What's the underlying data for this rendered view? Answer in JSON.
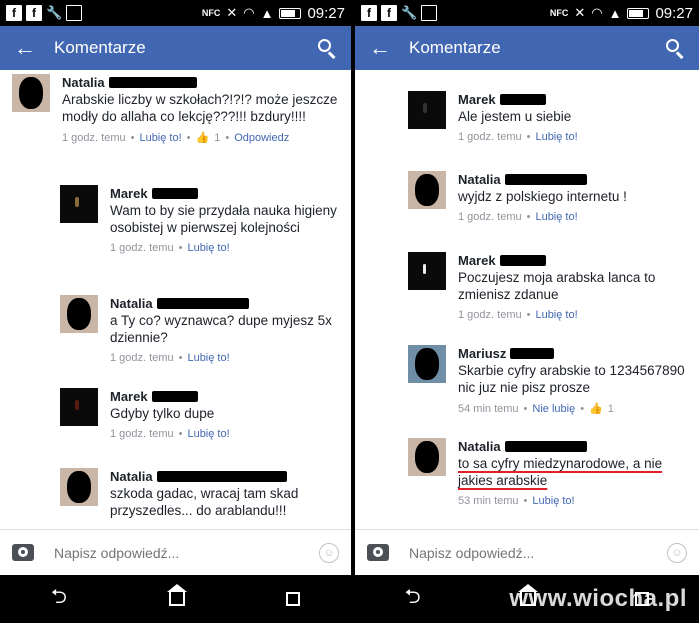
{
  "status": {
    "time": "09:27",
    "nfc": "NFC"
  },
  "appbar": {
    "title": "Komentarze"
  },
  "reply": {
    "placeholder": "Napisz odpowiedź..."
  },
  "left_comments": [
    {
      "name": "Natalia",
      "text": "Arabskie liczby w szkołach?!?!? może jeszcze modły do allaha co lekcję???!!! bzdury!!!!",
      "time": "1 godz. temu",
      "like": "Lubię to!",
      "likes": "1",
      "reply": "Odpowiedz"
    },
    {
      "name": "Marek",
      "text": "Wam to by sie przydała nauka higieny osobistej w pierwszej kolejności",
      "time": "1 godz. temu",
      "like": "Lubię to!"
    },
    {
      "name": "Natalia",
      "text": "a Ty co? wyznawca? dupe myjesz 5x dziennie?",
      "time": "1 godz. temu",
      "like": "Lubię to!"
    },
    {
      "name": "Marek",
      "text": "Gdyby tylko dupe",
      "time": "1 godz. temu",
      "like": "Lubię to!"
    },
    {
      "name": "Natalia",
      "text": "szkoda gadac, wracaj tam skad przyszedles... do arablandu!!!",
      "time": "",
      "like": ""
    }
  ],
  "right_comments": [
    {
      "name": "Marek",
      "text": "Ale jestem u siebie",
      "time": "1 godz. temu",
      "like": "Lubię to!"
    },
    {
      "name": "Natalia",
      "text": "wyjdz z polskiego internetu !",
      "time": "1 godz. temu",
      "like": "Lubię to!"
    },
    {
      "name": "Marek",
      "text": "Poczujesz moja arabska lanca to zmienisz zdanue",
      "time": "1 godz. temu",
      "like": "Lubię to!"
    },
    {
      "name": "Mariusz",
      "text": "Skarbie cyfry arabskie to 1234567890 nic juz nie pisz prosze",
      "time": "54 min temu",
      "like": "Nie lubię",
      "likes": "1"
    },
    {
      "name": "Natalia",
      "text": "to sa cyfry miedzynarodowe, a nie jakies arabskie",
      "time": "53 min temu",
      "like": "Lubię to!"
    }
  ],
  "watermark": "www.wiocha.pl"
}
